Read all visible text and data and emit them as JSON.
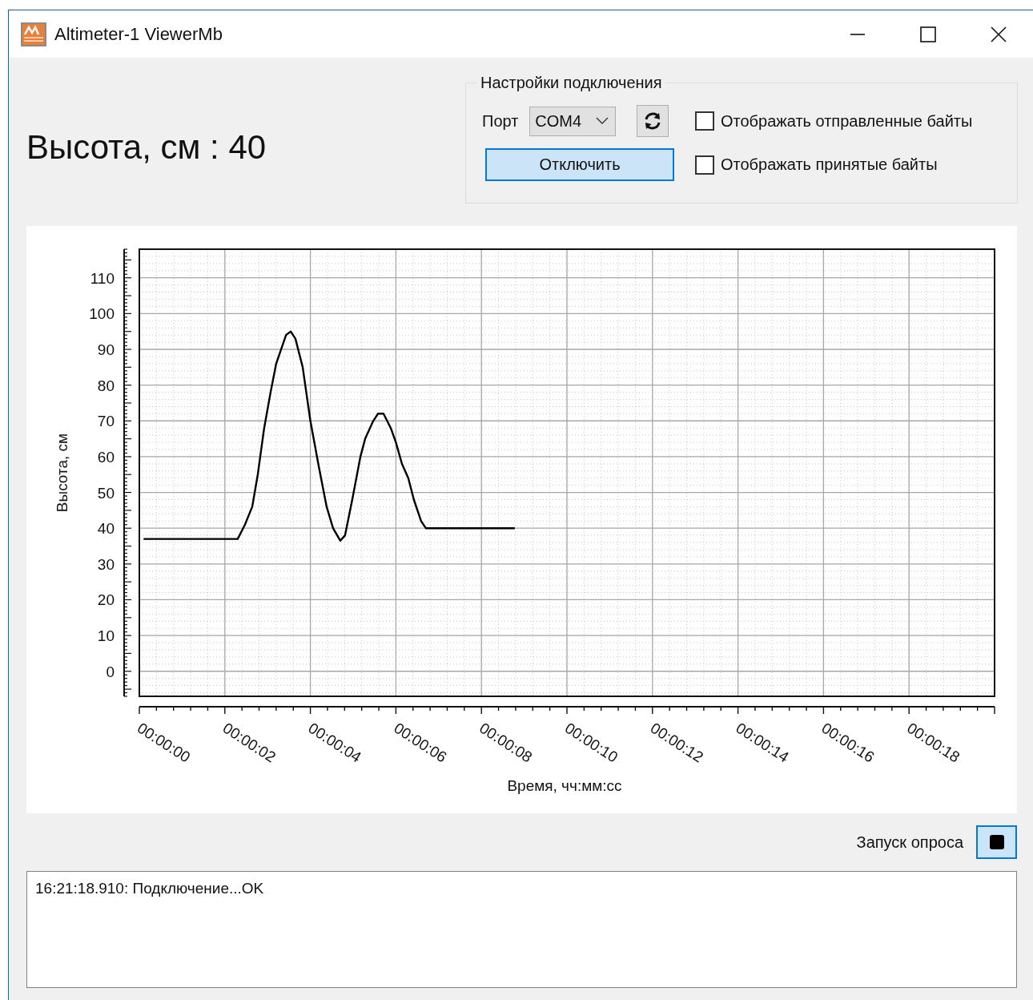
{
  "window": {
    "title": "Altimeter-1 ViewerMb"
  },
  "altitude_readout": "Высота, см : 40",
  "connection_settings": {
    "title": "Настройки подключения",
    "port_label": "Порт",
    "port_value": "COM4",
    "disconnect_button": "Отключить",
    "checkboxes": [
      {
        "label": "Отображать отправленные байты",
        "checked": false
      },
      {
        "label": "Отображать принятые байты",
        "checked": false
      }
    ]
  },
  "chart": {
    "chart_data": {
      "type": "line",
      "xlabel": "Время, чч:мм:сс",
      "ylabel": "Высота, см",
      "xlim": [
        0,
        20
      ],
      "ylim": [
        -7,
        118
      ],
      "x": [
        0.1,
        2.3,
        2.47,
        2.64,
        2.77,
        2.92,
        3.07,
        3.2,
        3.43,
        3.54,
        3.65,
        3.82,
        4.0,
        4.2,
        4.38,
        4.53,
        4.7,
        4.81,
        4.98,
        5.17,
        5.28,
        5.47,
        5.58,
        5.71,
        5.88,
        6.0,
        6.14,
        6.29,
        6.42,
        6.59,
        6.7,
        8.78
      ],
      "grid": true,
      "series": [
        {
          "color": "#000000",
          "values": [
            37,
            37,
            41,
            46,
            55,
            68,
            78,
            86,
            94,
            95,
            93,
            85,
            70,
            57,
            46,
            40,
            36.5,
            38,
            48,
            60,
            65,
            70,
            72,
            72,
            68,
            64,
            58,
            54,
            48,
            42,
            40,
            40
          ]
        }
      ],
      "xticks": [
        {
          "value": 0,
          "label": "00:00:00"
        },
        {
          "value": 2,
          "label": "00:00:02"
        },
        {
          "value": 4,
          "label": "00:00:04"
        },
        {
          "value": 6,
          "label": "00:00:06"
        },
        {
          "value": 8,
          "label": "00:00:08"
        },
        {
          "value": 10,
          "label": "00:00:10"
        },
        {
          "value": 12,
          "label": "00:00:12"
        },
        {
          "value": 14,
          "label": "00:00:14"
        },
        {
          "value": 16,
          "label": "00:00:16"
        },
        {
          "value": 18,
          "label": "00:00:18"
        }
      ],
      "yticks": [
        0,
        10,
        20,
        30,
        40,
        50,
        60,
        70,
        80,
        90,
        100,
        110
      ]
    }
  },
  "polling": {
    "label": "Запуск опроса"
  },
  "log": [
    "16:21:18.910: Подключение...OK"
  ]
}
